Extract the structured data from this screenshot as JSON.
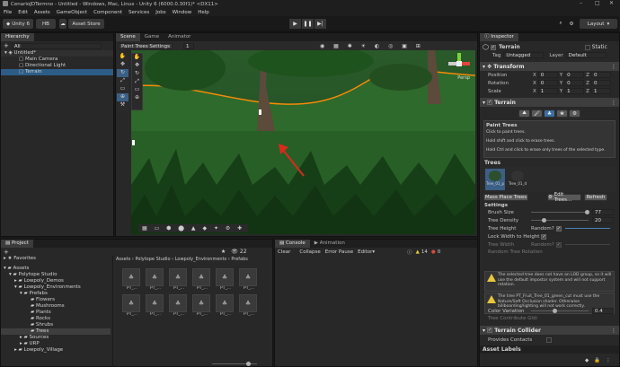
{
  "window": {
    "title": "CenarioJDTermno - Untitled - Windows, Mac, Linux - Unity 6 (6000.0.30f1)* <DX11>"
  },
  "menu": [
    "File",
    "Edit",
    "Assets",
    "GameObject",
    "Component",
    "Services",
    "Jobs",
    "Window",
    "Help"
  ],
  "toolbar": {
    "account": "Unity 6",
    "hb": "HB",
    "asset_store": "Asset Store",
    "layout": "Layout"
  },
  "hierarchy": {
    "tab": "Hierarchy",
    "search_placeholder": "All",
    "items": [
      {
        "label": "Untitled*"
      },
      {
        "label": "Main Camera"
      },
      {
        "label": "Directional Light"
      },
      {
        "label": "Terrain"
      }
    ]
  },
  "scene": {
    "tabs": [
      "Scene",
      "Game",
      "Animator"
    ],
    "paint_mode": "Paint Trees Settings",
    "paint_value": "1",
    "view": "Persp"
  },
  "project": {
    "tabs": [
      "Project",
      "Console",
      "Animation"
    ],
    "favorites": "Favorites",
    "tree": [
      {
        "label": "Assets",
        "depth": 0
      },
      {
        "label": "Polytope Studio",
        "depth": 1
      },
      {
        "label": "Lowpoly_Demos",
        "depth": 2
      },
      {
        "label": "Lowpoly_Environments",
        "depth": 2
      },
      {
        "label": "Prefabs",
        "depth": 3
      },
      {
        "label": "Flowers",
        "depth": 4
      },
      {
        "label": "Mushrooms",
        "depth": 4
      },
      {
        "label": "Plants",
        "depth": 4
      },
      {
        "label": "Rocks",
        "depth": 4
      },
      {
        "label": "Shrubs",
        "depth": 4
      },
      {
        "label": "Trees",
        "depth": 4
      },
      {
        "label": "Sources",
        "depth": 2
      },
      {
        "label": "URP",
        "depth": 2
      },
      {
        "label": "Lowpoly_Village",
        "depth": 2
      }
    ],
    "breadcrumb": [
      "Assets",
      "Polytope Studio",
      "Lowpoly_Environments",
      "Prefabs"
    ],
    "asset_label": "PT_...",
    "count": "22"
  },
  "console": {
    "clear": "Clear",
    "collapse": "Collapse",
    "error_pause": "Error Pause",
    "editor": "Editor",
    "warnings": "14",
    "errors": "0"
  },
  "inspector": {
    "tab": "Inspector",
    "object_name": "Terrain",
    "static_label": "Static",
    "tag_label": "Tag",
    "tag_value": "Untagged",
    "layer_label": "Layer",
    "layer_value": "Default",
    "transform": {
      "title": "Transform",
      "rows": [
        {
          "label": "Position",
          "x": "0",
          "y": "0",
          "z": "0"
        },
        {
          "label": "Rotation",
          "x": "0",
          "y": "0",
          "z": "0"
        },
        {
          "label": "Scale",
          "x": "1",
          "y": "1",
          "z": "1"
        }
      ]
    },
    "terrain": {
      "title": "Terrain",
      "paint_title": "Paint Trees",
      "help": [
        "Click to paint trees.",
        "Hold shift and click to erase trees.",
        "Hold Ctrl and click to erase only trees of the selected type."
      ],
      "trees_label": "Trees",
      "tree_items": [
        "Tree_01_p",
        "Tree_01_d"
      ],
      "mass_place": "Mass Place Trees",
      "edit_trees": "Edit Trees...",
      "refresh": "Refresh",
      "settings_label": "Settings",
      "brush_size_label": "Brush Size",
      "brush_size": "77",
      "tree_density_label": "Tree Density",
      "tree_density": "20",
      "tree_height_label": "Tree Height",
      "random_label": "Random?",
      "lock_width": "Lock Width to Height",
      "tree_width_label": "Tree Width",
      "random_rotation": "Random Tree Rotation",
      "warn1": "The selected tree does not have an LOD group, so it will use the default impostor system and will not support rotation.",
      "warn2": "The tree PT_Fruit_Tree_01_green_cut must use the Nature/Soft Occlusion shader. Otherwise billboarding/lighting will not work correctly.",
      "color_variation_label": "Color Variation",
      "color_variation": "0.4",
      "tree_contribute": "Tree Contribute GIdi"
    },
    "collider": {
      "title": "Terrain Collider",
      "provides_contacts": "Provides Contacts"
    },
    "asset_labels": "Asset Labels"
  },
  "colors": {
    "accent": "#2c5d87",
    "orange": "#f58a07",
    "arrow": "#d92a1c",
    "grass": "#2f6b2a"
  }
}
